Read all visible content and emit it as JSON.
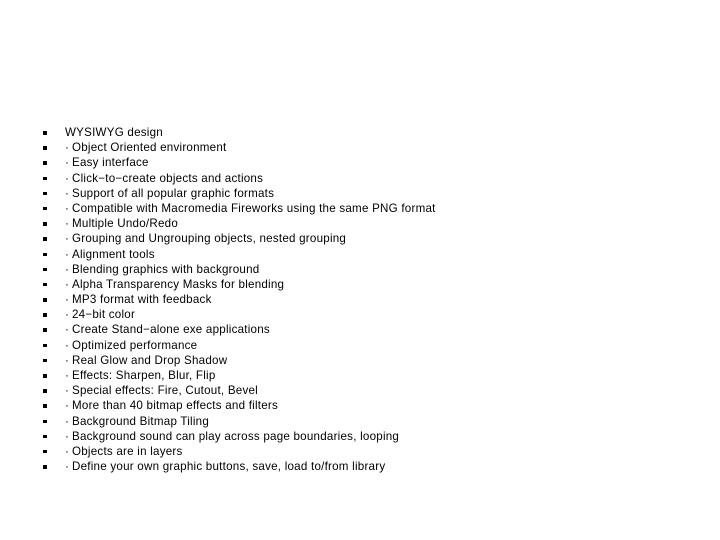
{
  "slide": {
    "background_color": "#ffffff",
    "text_color": "#000000",
    "bullet_glyph": "filled-square",
    "sub_prefix": "·"
  },
  "features": [
    {
      "prefix": "",
      "text": "WYSIWYG design"
    },
    {
      "prefix": "·",
      "text": "Object Oriented environment"
    },
    {
      "prefix": "·",
      "text": "Easy interface"
    },
    {
      "prefix": "·",
      "text": "Click−to−create objects and actions"
    },
    {
      "prefix": "·",
      "text": "Support of all popular graphic formats"
    },
    {
      "prefix": "·",
      "text": "Compatible with Macromedia Fireworks using the same PNG format"
    },
    {
      "prefix": "·",
      "text": "Multiple Undo/Redo"
    },
    {
      "prefix": "·",
      "text": "Grouping and Ungrouping objects, nested grouping"
    },
    {
      "prefix": "·",
      "text": "Alignment tools"
    },
    {
      "prefix": "·",
      "text": "Blending graphics with background"
    },
    {
      "prefix": "·",
      "text": "Alpha Transparency Masks for blending"
    },
    {
      "prefix": "·",
      "text": "MP3 format with feedback"
    },
    {
      "prefix": "·",
      "text": "24−bit color"
    },
    {
      "prefix": "·",
      "text": "Create Stand−alone exe applications"
    },
    {
      "prefix": "·",
      "text": "Optimized performance"
    },
    {
      "prefix": "·",
      "text": "Real Glow and Drop Shadow"
    },
    {
      "prefix": "·",
      "text": "Effects: Sharpen, Blur, Flip"
    },
    {
      "prefix": "·",
      "text": "Special effects: Fire, Cutout, Bevel"
    },
    {
      "prefix": "·",
      "text": "More than 40 bitmap effects and filters"
    },
    {
      "prefix": "·",
      "text": "Background Bitmap Tiling"
    },
    {
      "prefix": "·",
      "text": "Background sound can play across page boundaries, looping"
    },
    {
      "prefix": "·",
      "text": "Objects are in layers"
    },
    {
      "prefix": "·",
      "text": "Define your own graphic buttons, save, load to/from library"
    }
  ]
}
